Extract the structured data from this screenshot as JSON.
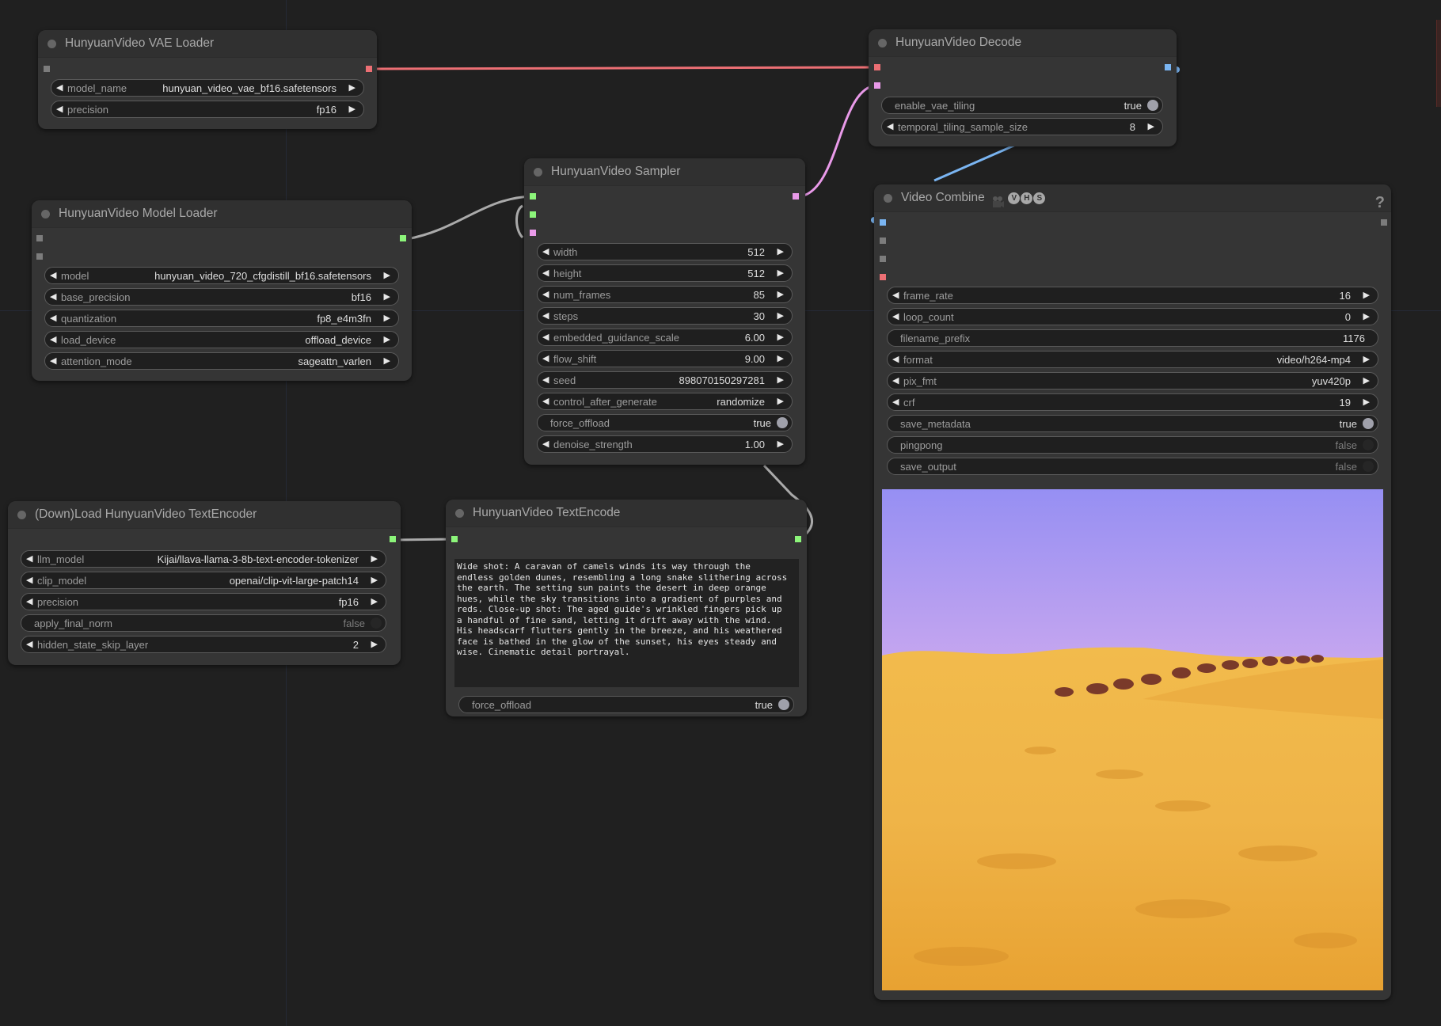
{
  "canvas": {
    "background": "#202020",
    "wire_colors": {
      "vae": "#ec6f74",
      "latent": "#e99ae9",
      "model": "#aaaaaa",
      "embeds": "#aaaaaa",
      "images": "#7ab5f2"
    }
  },
  "nodes": {
    "vae_loader": {
      "title": "HunyuanVideo VAE Loader",
      "widgets": [
        {
          "label": "model_name",
          "value": "hunyuan_video_vae_bf16.safetensors"
        },
        {
          "label": "precision",
          "value": "fp16"
        }
      ]
    },
    "decode": {
      "title": "HunyuanVideo Decode",
      "widgets": [
        {
          "label": "enable_vae_tiling",
          "value": "true"
        },
        {
          "label": "temporal_tiling_sample_size",
          "value": "8"
        }
      ]
    },
    "model_loader": {
      "title": "HunyuanVideo Model Loader",
      "widgets": [
        {
          "label": "model",
          "value": "hunyuan_video_720_cfgdistill_bf16.safetensors"
        },
        {
          "label": "base_precision",
          "value": "bf16"
        },
        {
          "label": "quantization",
          "value": "fp8_e4m3fn"
        },
        {
          "label": "load_device",
          "value": "offload_device"
        },
        {
          "label": "attention_mode",
          "value": "sageattn_varlen"
        }
      ]
    },
    "sampler": {
      "title": "HunyuanVideo Sampler",
      "widgets": [
        {
          "label": "width",
          "value": "512"
        },
        {
          "label": "height",
          "value": "512"
        },
        {
          "label": "num_frames",
          "value": "85"
        },
        {
          "label": "steps",
          "value": "30"
        },
        {
          "label": "embedded_guidance_scale",
          "value": "6.00"
        },
        {
          "label": "flow_shift",
          "value": "9.00"
        },
        {
          "label": "seed",
          "value": "898070150297281"
        },
        {
          "label": "control_after_generate",
          "value": "randomize"
        },
        {
          "label": "force_offload",
          "value": "true"
        },
        {
          "label": "denoise_strength",
          "value": "1.00"
        }
      ]
    },
    "video_combine": {
      "title": "Video Combine",
      "badges": [
        "V",
        "H",
        "S"
      ],
      "help": "?",
      "widgets": [
        {
          "label": "frame_rate",
          "value": "16"
        },
        {
          "label": "loop_count",
          "value": "0"
        },
        {
          "label": "filename_prefix",
          "value": "1176"
        },
        {
          "label": "format",
          "value": "video/h264-mp4"
        },
        {
          "label": "pix_fmt",
          "value": "yuv420p"
        },
        {
          "label": "crf",
          "value": "19"
        },
        {
          "label": "save_metadata",
          "value": "true"
        },
        {
          "label": "pingpong",
          "value": "false"
        },
        {
          "label": "save_output",
          "value": "false"
        }
      ],
      "preview": {
        "description": "Caravan of camels crossing golden desert dunes under a purple sky"
      }
    },
    "textencoder_loader": {
      "title": "(Down)Load HunyuanVideo TextEncoder",
      "widgets": [
        {
          "label": "llm_model",
          "value": "Kijai/llava-llama-3-8b-text-encoder-tokenizer"
        },
        {
          "label": "clip_model",
          "value": "openai/clip-vit-large-patch14"
        },
        {
          "label": "precision",
          "value": "fp16"
        },
        {
          "label": "apply_final_norm",
          "value": "false"
        },
        {
          "label": "hidden_state_skip_layer",
          "value": "2"
        }
      ]
    },
    "textencode": {
      "title": "HunyuanVideo TextEncode",
      "prompt": "Wide shot: A caravan of camels winds its way through the\nendless golden dunes, resembling a long snake slithering across\nthe earth. The setting sun paints the desert in deep orange\nhues, while the sky transitions into a gradient of purples and\nreds. Close-up shot: The aged guide's wrinkled fingers pick up\na handful of fine sand, letting it drift away with the wind.\nHis headscarf flutters gently in the breeze, and his weathered\nface is bathed in the glow of the sunset, his eyes steady and\nwise. Cinematic detail portrayal.",
      "widgets": [
        {
          "label": "force_offload",
          "value": "true"
        }
      ]
    }
  }
}
